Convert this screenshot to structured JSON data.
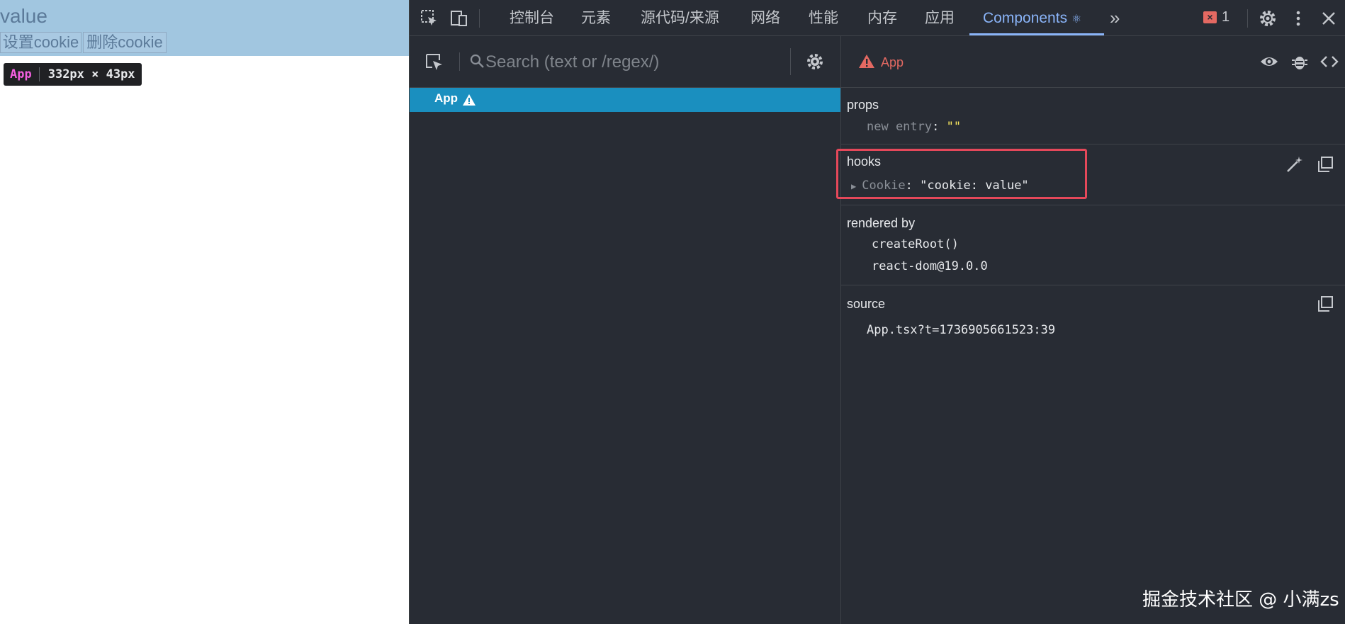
{
  "page": {
    "value_text": "value",
    "set_button": "设置cookie",
    "delete_button": "删除cookie",
    "tooltip": {
      "component": "App",
      "size": "332px × 43px"
    }
  },
  "devtools": {
    "tabs": [
      "控制台",
      "元素",
      "源代码/来源",
      "网络",
      "性能",
      "内存",
      "应用"
    ],
    "active_tab": "Components",
    "error_count": "1",
    "tree": {
      "search_placeholder": "Search (text or /regex/)",
      "selected_item": "App"
    },
    "detail": {
      "component_name": "App",
      "props": {
        "title": "props",
        "new_entry_key": "new entry",
        "new_entry_value": "\"\""
      },
      "hooks": {
        "title": "hooks",
        "hook_name": "Cookie",
        "hook_value": "\"cookie: value\""
      },
      "rendered_by": {
        "title": "rendered by",
        "items": [
          "createRoot()",
          "react-dom@19.0.0"
        ]
      },
      "source": {
        "title": "source",
        "file": "App.tsx?t=1736905661523:39"
      }
    },
    "colors": {
      "background": "#282c34",
      "selected_row": "#1a8fbf",
      "active_tab": "#8ab4f8",
      "warning": "#e46962",
      "highlight_box": "#e5485a",
      "string_value": "#f9e75f"
    }
  },
  "watermark": "掘金技术社区 @ 小满zs"
}
